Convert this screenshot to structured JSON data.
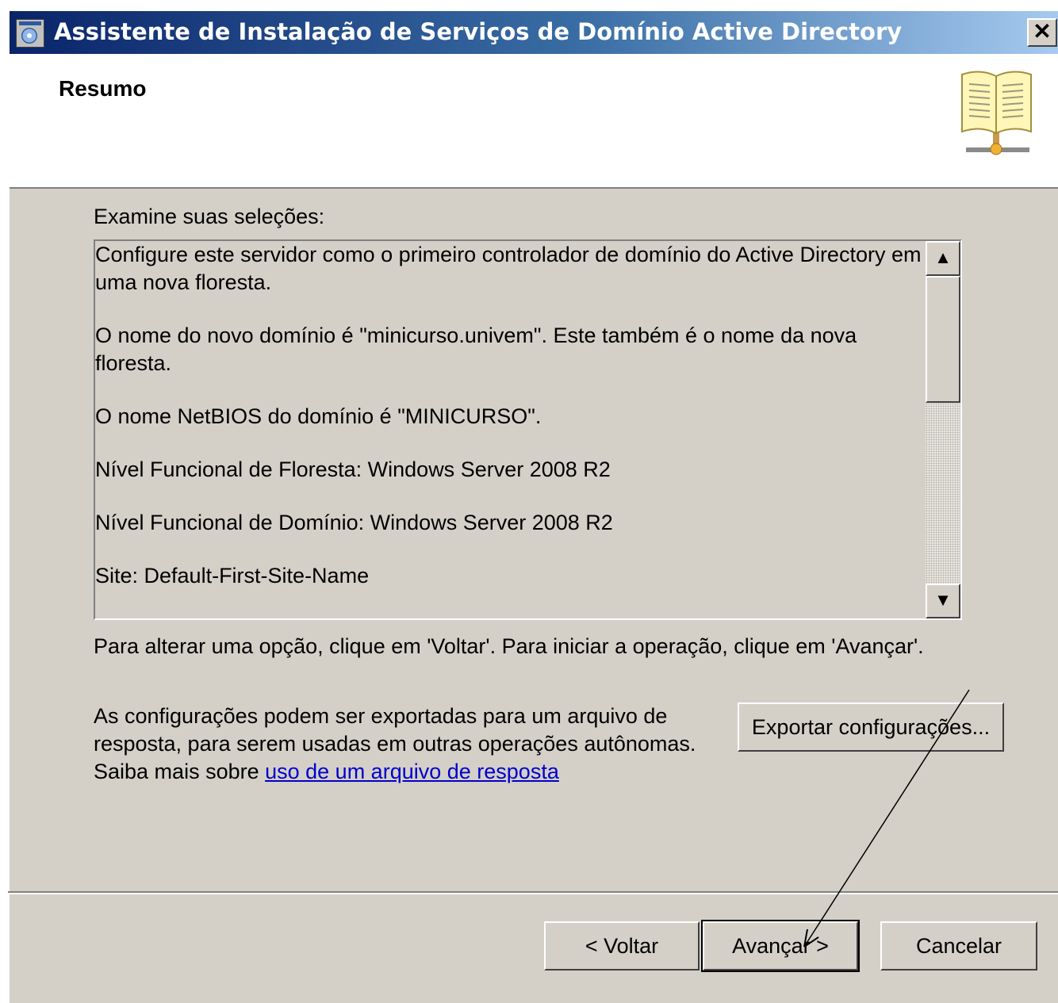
{
  "window": {
    "title": "Assistente de Instalação de Serviços de Domínio Active Directory",
    "close_label": "✕"
  },
  "header": {
    "title": "Resumo",
    "icon": "book-network-icon"
  },
  "content": {
    "label": "Examine suas seleções:",
    "summary": [
      "Configure este servidor como o primeiro controlador de domínio do Active Directory em uma nova floresta.",
      "O nome do novo domínio é \"minicurso.univem\". Este também é o nome da nova floresta.",
      "O nome NetBIOS do domínio é \"MINICURSO\".",
      "Nível Funcional de Floresta: Windows Server 2008 R2",
      "Nível Funcional de Domínio: Windows Server 2008 R2",
      "Site: Default-First-Site-Name"
    ],
    "instruction": "Para alterar uma opção, clique em 'Voltar'. Para iniciar a operação, clique em 'Avançar'.",
    "export_text_1": "As configurações podem ser exportadas para um arquivo de resposta, para serem usadas em outras operações autônomas.",
    "export_text_2": "Saiba mais sobre ",
    "export_link": "uso de um arquivo de resposta",
    "export_button": "Exportar configurações..."
  },
  "footer": {
    "back": "< Voltar",
    "next": "Avançar >",
    "cancel": "Cancelar"
  },
  "colors": {
    "titlebar_start": "#0a246a",
    "titlebar_end": "#a6caf0",
    "face": "#d4d0c8",
    "link": "#0000cc"
  }
}
